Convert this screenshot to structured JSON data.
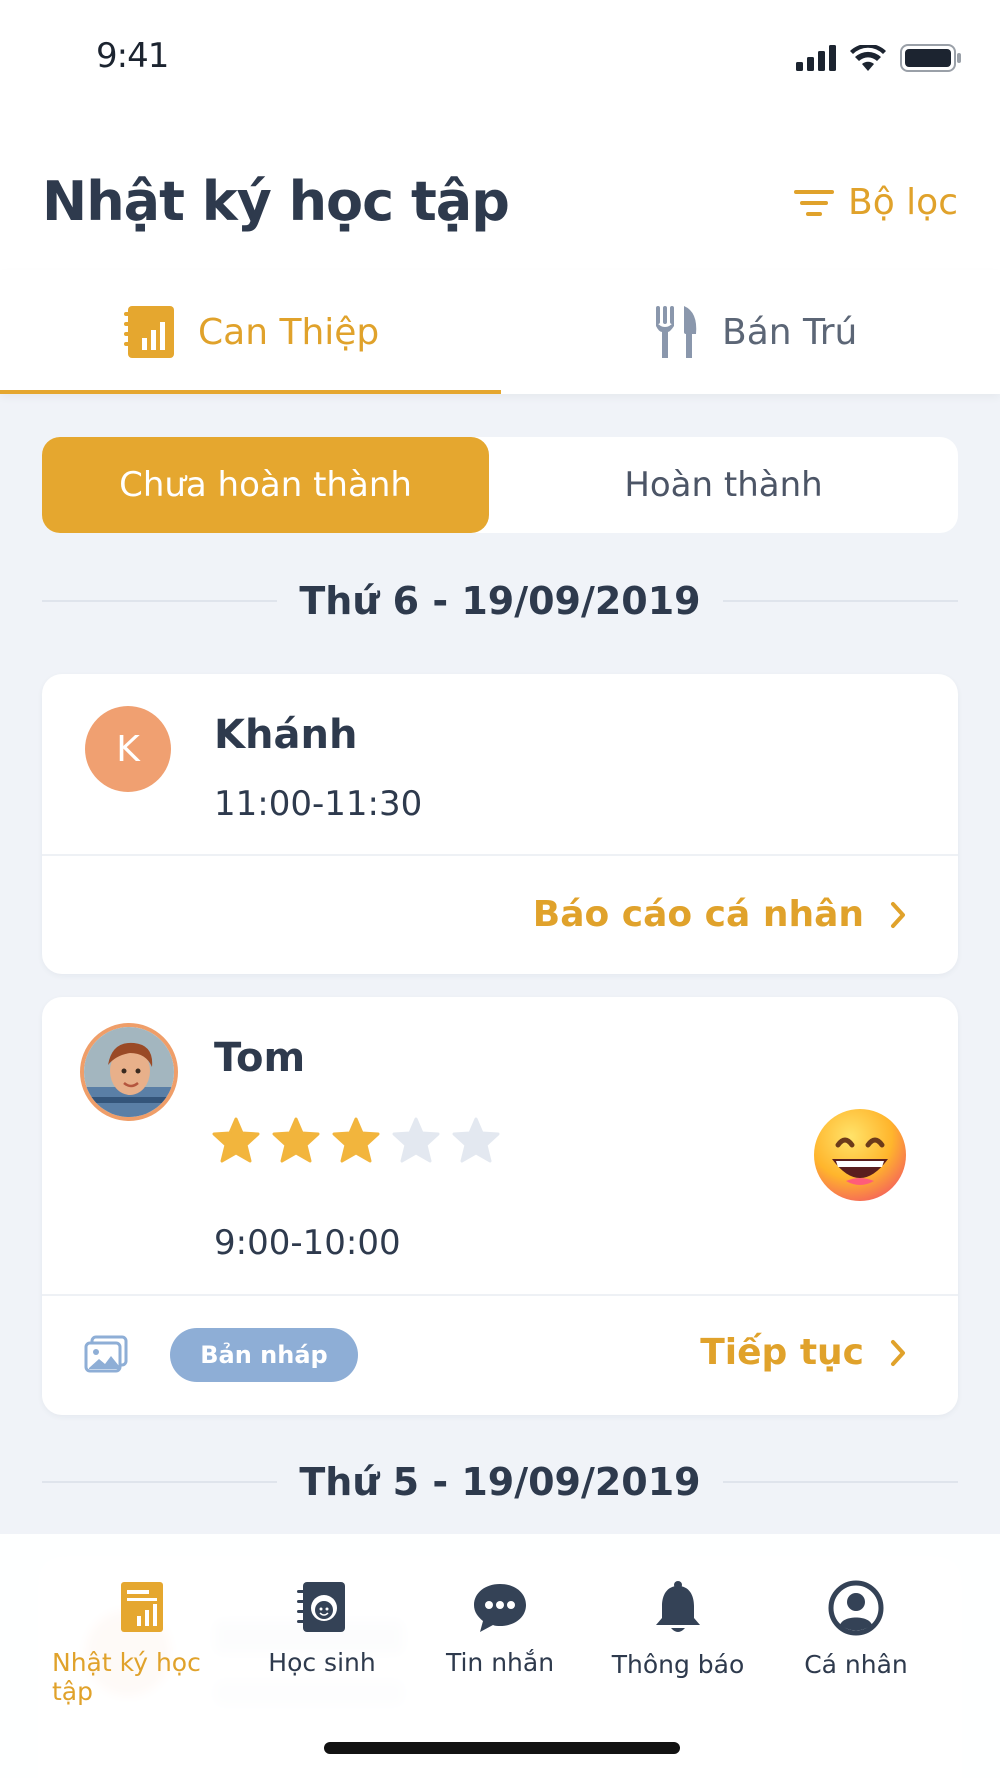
{
  "status": {
    "time": "9:41"
  },
  "header": {
    "title": "Nhật ký học tập",
    "filter_label": "Bộ lọc"
  },
  "tabs": [
    {
      "label": "Can Thiệp",
      "icon": "report-chart-icon",
      "active": true
    },
    {
      "label": "Bán Trú",
      "icon": "fork-knife-icon",
      "active": false
    }
  ],
  "segment": {
    "active": "Chưa hoàn thành",
    "inactive": "Hoàn thành"
  },
  "groups": [
    {
      "date": "Thứ 6 - 19/09/2019",
      "entries": [
        {
          "avatar_letter": "K",
          "name": "Khánh",
          "time": "11:00-11:30",
          "action": "Báo cáo cá nhân"
        },
        {
          "name": "Tom",
          "rating": 3,
          "rating_max": 5,
          "mood": "grinning-emoji",
          "time": "9:00-10:00",
          "badge": "Bản nháp",
          "action": "Tiếp tục"
        }
      ]
    },
    {
      "date": "Thứ 5 - 19/09/2019"
    }
  ],
  "bottom_nav": [
    {
      "label": "Nhật ký học tập",
      "icon": "journal-icon",
      "active": true
    },
    {
      "label": "Học sinh",
      "icon": "student-book-icon",
      "active": false
    },
    {
      "label": "Tin nhắn",
      "icon": "chat-bubble-icon",
      "active": false
    },
    {
      "label": "Thông báo",
      "icon": "bell-icon",
      "active": false
    },
    {
      "label": "Cá nhân",
      "icon": "profile-icon",
      "active": false
    }
  ],
  "colors": {
    "accent": "#E5A72F",
    "text": "#2E3A4D",
    "background": "#F0F3F8",
    "draft_badge": "#8EAED6"
  }
}
